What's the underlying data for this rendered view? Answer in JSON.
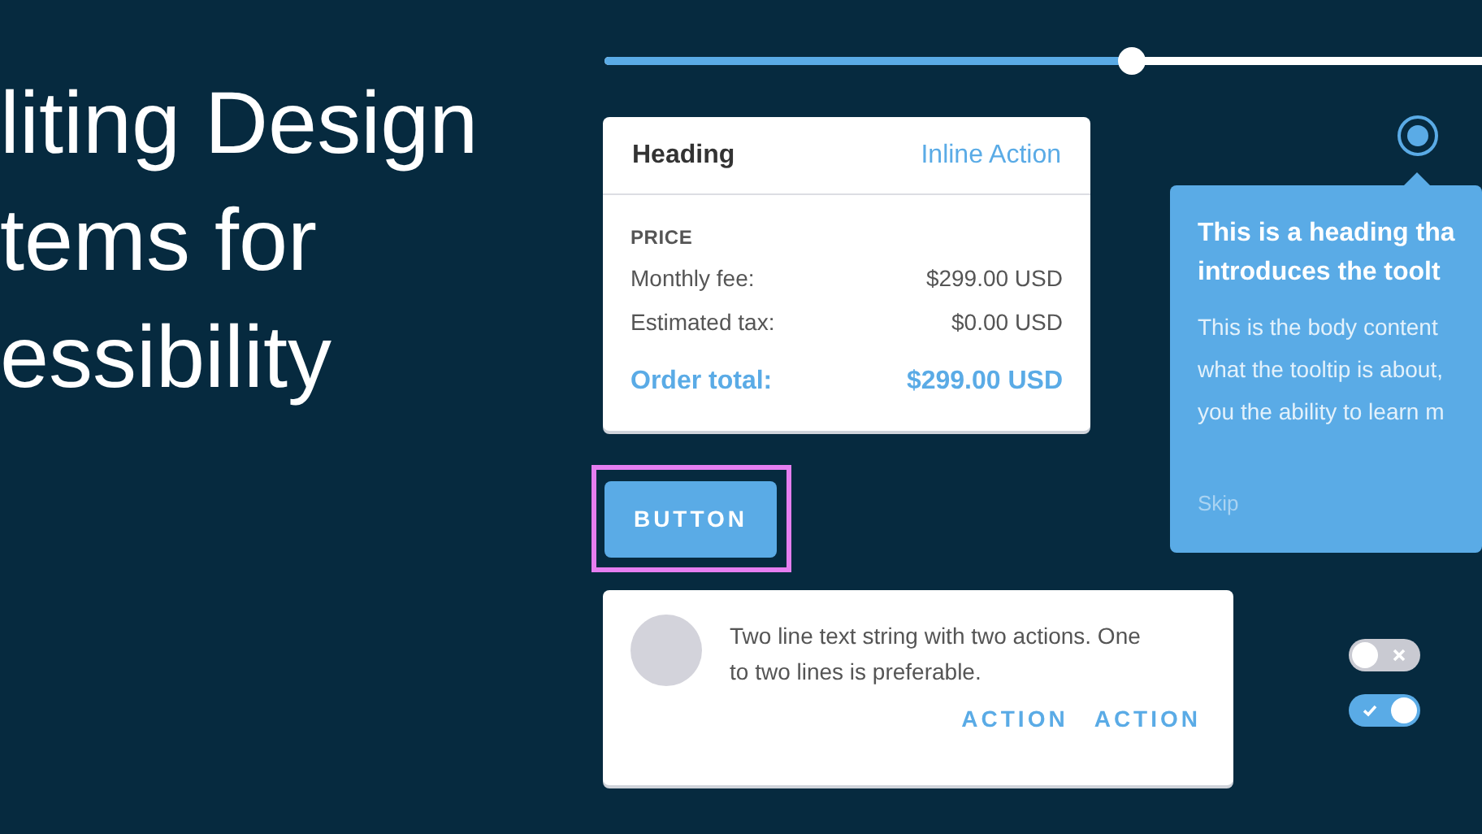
{
  "title_lines": [
    "liting Design",
    "tems for",
    "essibility"
  ],
  "slider": {
    "level": 0.6
  },
  "price_card": {
    "heading": "Heading",
    "inline_action": "Inline Action",
    "section_label": "PRICE",
    "rows": [
      {
        "label": "Monthly fee:",
        "value": "$299.00 USD"
      },
      {
        "label": "Estimated tax:",
        "value": "$0.00 USD"
      }
    ],
    "total": {
      "label": "Order total:",
      "value": "$299.00 USD"
    }
  },
  "button": {
    "label": "BUTTON",
    "focused": true
  },
  "radio": {
    "selected": true
  },
  "tooltip": {
    "heading_lines": [
      "This is a heading tha",
      "introduces the toolt"
    ],
    "body_lines": [
      "This is the body content",
      "what the tooltip is about,",
      "you the ability to learn m"
    ],
    "skip": "Skip"
  },
  "list_item": {
    "text": "Two line text string with two actions. One to two lines is preferable.",
    "actions": [
      "ACTION",
      "ACTION"
    ]
  },
  "toggles": [
    {
      "on": false
    },
    {
      "on": true
    }
  ]
}
